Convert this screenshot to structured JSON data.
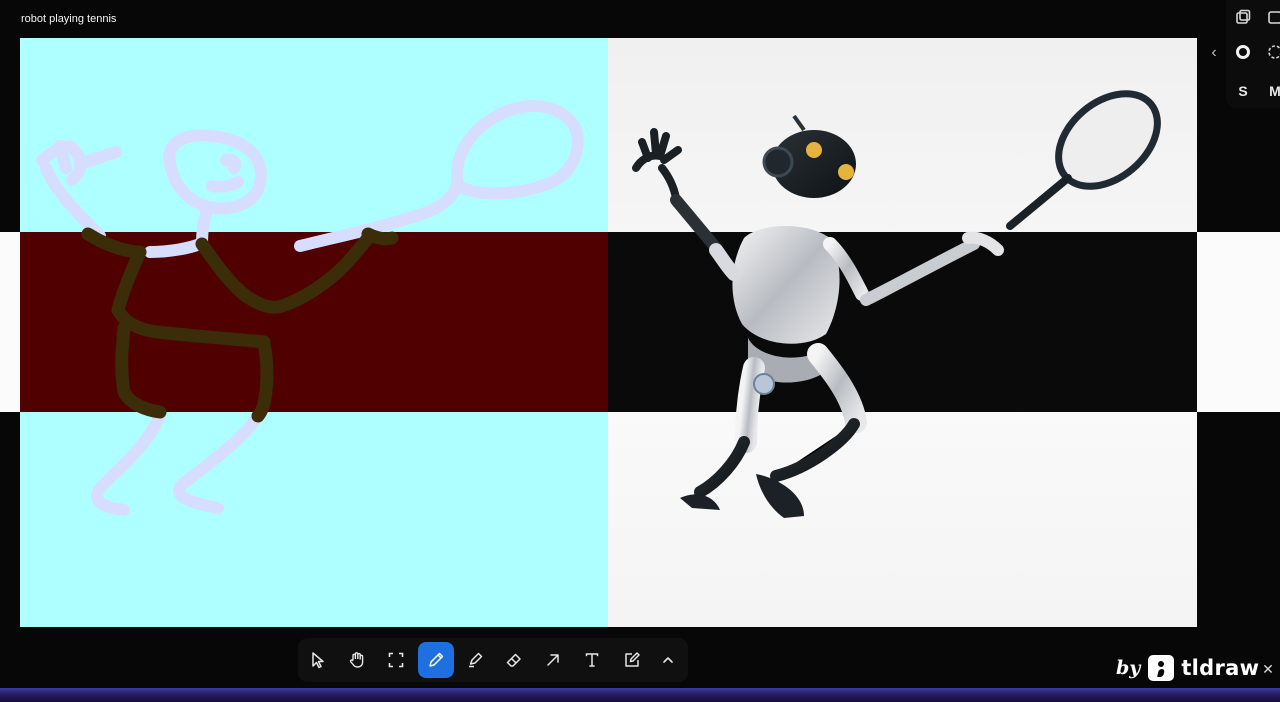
{
  "window": {
    "prompt_text": "robot playing tennis"
  },
  "colors": {
    "drawing_background": "#aeffff",
    "drawing_band": "#510000",
    "sketch_stroke": "#d6ddff",
    "accent": "#1e6fe0",
    "app_background": "#070708"
  },
  "style_panel": {
    "collapse_icon": "chevron-left-icon",
    "row1": [
      "duplicate-icon",
      "frame-icon"
    ],
    "row2": [
      "fill-solid-icon",
      "dash-dotted-icon"
    ],
    "size_labels": [
      "S",
      "M"
    ]
  },
  "toolbar": {
    "tools": [
      {
        "name": "select",
        "icon": "cursor-arrow-icon",
        "active": false
      },
      {
        "name": "hand",
        "icon": "hand-icon",
        "active": false
      },
      {
        "name": "frame",
        "icon": "frame-select-icon",
        "active": false
      },
      {
        "name": "draw",
        "icon": "pencil-icon",
        "active": true
      },
      {
        "name": "highlight",
        "icon": "marker-icon",
        "active": false
      },
      {
        "name": "eraser",
        "icon": "eraser-icon",
        "active": false
      },
      {
        "name": "arrow",
        "icon": "arrow-up-right-icon",
        "active": false
      },
      {
        "name": "text",
        "icon": "text-icon",
        "active": false
      },
      {
        "name": "note",
        "icon": "edit-note-icon",
        "active": false
      },
      {
        "name": "more",
        "icon": "chevron-up-icon",
        "active": false
      }
    ]
  },
  "brand": {
    "by_text": "by",
    "name": "tldraw",
    "close_icon": "close-icon"
  }
}
